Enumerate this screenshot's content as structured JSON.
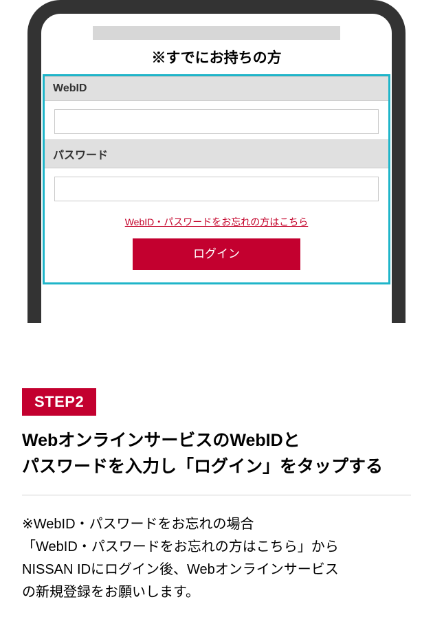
{
  "mockup": {
    "header_title": "※すでにお持ちの方",
    "form": {
      "webid_label": "WebID",
      "password_label": "パスワード",
      "forgot_link_text": "WebID・パスワードをお忘れの方はこちら",
      "login_button_label": "ログイン"
    }
  },
  "content": {
    "step_badge": "STEP2",
    "heading_line1": "WebオンラインサービスのWebIDと",
    "heading_line2": "パスワードを入力し「ログイン」をタップする",
    "note_line1": "※WebID・パスワードをお忘れの場合",
    "note_line2": "「WebID・パスワードをお忘れの方はこちら」から",
    "note_line3": "NISSAN IDにログイン後、Webオンラインサービス",
    "note_line4": "の新規登録をお願いします。"
  },
  "colors": {
    "accent": "#c3002f",
    "highlight_border": "#1fb5c9"
  }
}
